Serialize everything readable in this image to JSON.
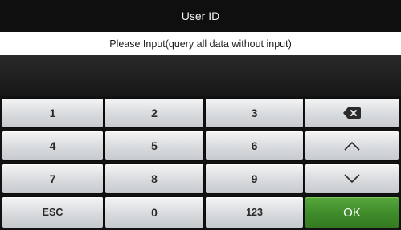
{
  "header": {
    "title": "User ID"
  },
  "prompt": {
    "text": "Please Input(query all data without input)"
  },
  "input": {
    "value": ""
  },
  "keypad": {
    "rows": [
      [
        {
          "label": "1"
        },
        {
          "label": "2"
        },
        {
          "label": "3"
        },
        {
          "label": "",
          "icon": "backspace-icon"
        }
      ],
      [
        {
          "label": "4"
        },
        {
          "label": "5"
        },
        {
          "label": "6"
        },
        {
          "label": "",
          "icon": "chevron-up-icon"
        }
      ],
      [
        {
          "label": "7"
        },
        {
          "label": "8"
        },
        {
          "label": "9"
        },
        {
          "label": "",
          "icon": "chevron-down-icon"
        }
      ],
      [
        {
          "label": "ESC"
        },
        {
          "label": "0"
        },
        {
          "label": "123"
        },
        {
          "label": "OK"
        }
      ]
    ]
  },
  "colors": {
    "ok_green": "#3f8b2a",
    "title_bg": "#0f0f0f",
    "key_gray": "#d8dbde"
  }
}
